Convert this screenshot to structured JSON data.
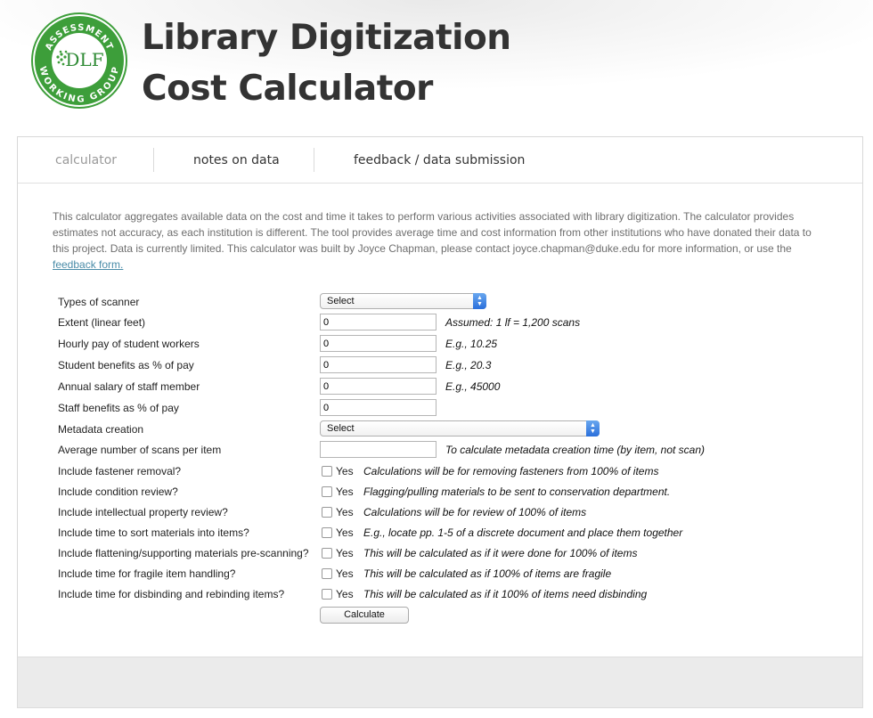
{
  "colors": {
    "logo_green": "#3a9b3a",
    "link": "#4a8ca8",
    "select_arrow": "#2a6fdb"
  },
  "logo": {
    "top_text": "ASSESSMENT",
    "center_text": "DLF",
    "bottom_text": "WORKING GROUP"
  },
  "header": {
    "title_line1": "Library Digitization",
    "title_line2": "Cost Calculator"
  },
  "nav": {
    "tabs": [
      {
        "label": "calculator"
      },
      {
        "label": "notes on data"
      },
      {
        "label": "feedback / data submission"
      }
    ]
  },
  "intro": {
    "text": "This calculator aggregates available data on the cost and time it takes to perform various activities associated with library digitization. The calculator provides estimates not accuracy, as each institution is different. The tool provides average time and cost information from other institutions who have donated their data to this project. Data is currently limited. This calculator was built by Joyce Chapman, please contact joyce.chapman@duke.edu for more information, or use the ",
    "link": "feedback form."
  },
  "form": {
    "scanner_type": {
      "label": "Types of scanner",
      "selected": "Select"
    },
    "extent": {
      "label": "Extent (linear feet)",
      "value": "0",
      "note": "Assumed: 1 lf = 1,200 scans"
    },
    "hourly_pay": {
      "label": "Hourly pay of student workers",
      "value": "0",
      "note": "E.g., 10.25"
    },
    "student_benefits": {
      "label": "Student benefits as % of pay",
      "value": "0",
      "note": "E.g., 20.3"
    },
    "annual_salary": {
      "label": "Annual salary of staff member",
      "value": "0",
      "note": "E.g., 45000"
    },
    "staff_benefits": {
      "label": "Staff benefits as % of pay",
      "value": "0"
    },
    "metadata": {
      "label": "Metadata creation",
      "selected": "Select"
    },
    "scans_per_item": {
      "label": "Average number of scans per item",
      "value": "",
      "note": "To calculate metadata creation time (by item, not scan)"
    },
    "checkbox_yes": "Yes",
    "options": [
      {
        "label": "Include fastener removal?",
        "note": "Calculations will be for removing fasteners from 100% of items"
      },
      {
        "label": "Include condition review?",
        "note": "Flagging/pulling materials to be sent to conservation department."
      },
      {
        "label": "Include intellectual property review?",
        "note": "Calculations will be for review of 100% of items"
      },
      {
        "label": "Include time to sort materials into items?",
        "note": "E.g., locate pp. 1-5 of a discrete document and place them together"
      },
      {
        "label": "Include flattening/supporting materials pre-scanning?",
        "note": "This will be calculated as if it were done for 100% of items"
      },
      {
        "label": "Include time for fragile item handling?",
        "note": "This will be calculated as if 100% of items are fragile"
      },
      {
        "label": "Include time for disbinding and rebinding items?",
        "note": "This will be calculated as if it 100% of items need disbinding"
      }
    ],
    "calculate_label": "Calculate"
  }
}
